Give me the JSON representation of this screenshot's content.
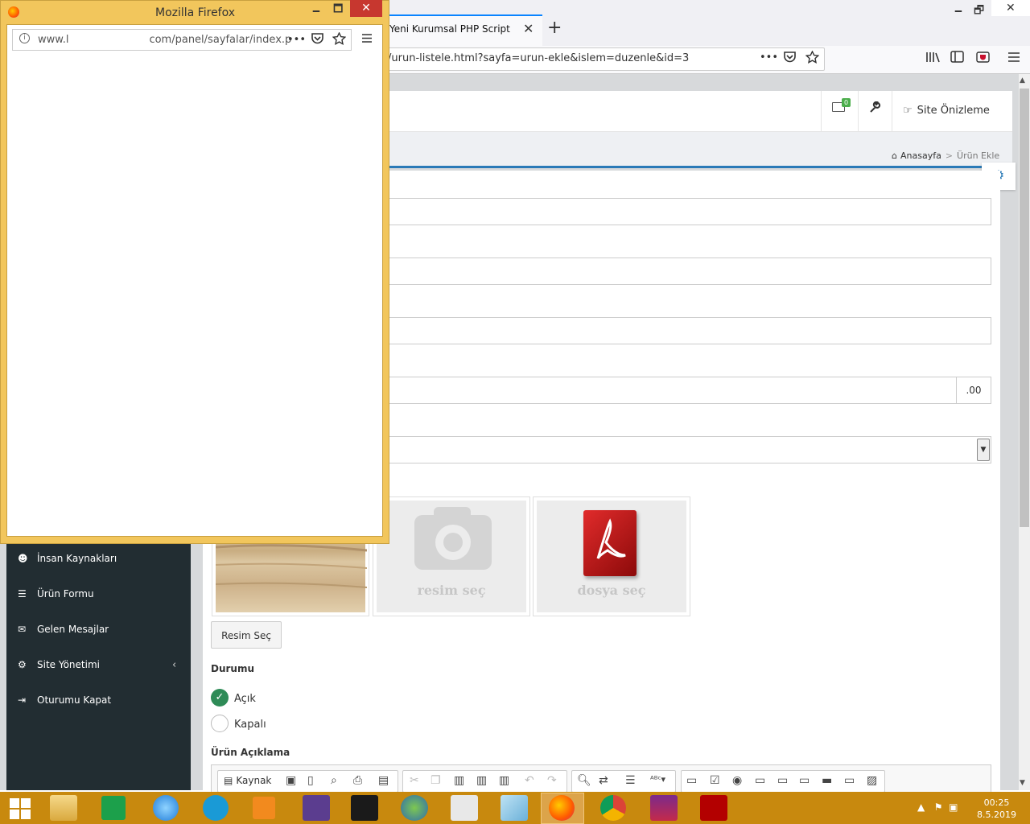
{
  "browser": {
    "tab_title": "Yeni Kurumsal PHP Script",
    "tab_close": "✕",
    "new_tab": "+",
    "url": "/urun-listele.html?sayfa=urun-ekle&islem=duzenle&id=3",
    "more": "•••",
    "window_min": "🗕",
    "window_max": "🗗",
    "window_close": "✕"
  },
  "header": {
    "mail_badge": "0",
    "preview_label": "Site Önizleme"
  },
  "breadcrumb": {
    "home": "Anasayfa",
    "separator": ">",
    "current": "Ürün Ekle"
  },
  "form": {
    "price_suffix": ".00",
    "thumb_select_image": "resim seç",
    "thumb_select_file": "dosya seç",
    "select_image_button": "Resim Seç",
    "status_label": "Durumu",
    "status_options": [
      "Açık",
      "Kapalı"
    ],
    "description_label": "Ürün Açıklama",
    "editor_source_button": "Kaynak"
  },
  "sidebar": {
    "items": [
      {
        "label": "İnsan Kaynakları",
        "icon": "users-icon"
      },
      {
        "label": "Ürün Formu",
        "icon": "list-icon"
      },
      {
        "label": "Gelen Mesajlar",
        "icon": "envelope-icon"
      },
      {
        "label": "Site Yönetimi",
        "icon": "cogs-icon"
      },
      {
        "label": "Oturumu Kapat",
        "icon": "sign-out-icon"
      }
    ]
  },
  "popup": {
    "title": "Mozilla Firefox",
    "url_prefix": "www.l",
    "url_suffix": "com/panel/sayfalar/index.p",
    "more": "•••",
    "close": "✕",
    "min": "🗕",
    "max": "🗖"
  },
  "taskbar": {
    "time": "00:25",
    "date": "8.5.2019"
  },
  "colors": {
    "accent_blue": "#2a7ab7",
    "sidebar_bg": "#222d32",
    "taskbar_bg": "#c8890e",
    "popup_frame": "#f2c65c",
    "radio_checked": "#2e8b57"
  }
}
